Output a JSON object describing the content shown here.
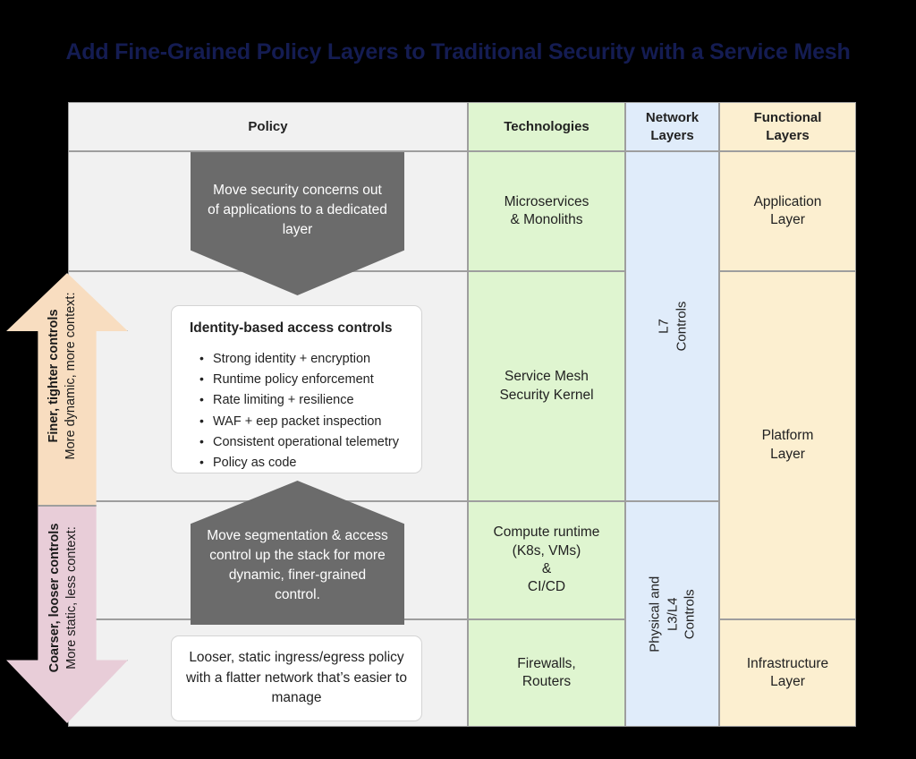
{
  "title": "Add Fine-Grained Policy Layers to Traditional Security with a Service Mesh",
  "colors": {
    "title": "#141c52",
    "policy_column": "#f1f1f1",
    "technologies_column": "#dff5d0",
    "network_layers_column": "#e0ecfa",
    "functional_layers_column": "#fcefd0",
    "callout_gray": "#6b6b6b",
    "arrow_up": "#f8ddc0",
    "arrow_down": "#e8cdd8",
    "card_white": "#ffffff",
    "border": "#9e9e9e"
  },
  "table": {
    "headers": [
      {
        "label": "Policy"
      },
      {
        "label": "Technologies"
      },
      {
        "label": "Network\nLayers"
      },
      {
        "label": "Functional\nLayers"
      }
    ],
    "technologies": [
      {
        "label": "Microservices\n& Monoliths"
      },
      {
        "label": "Service Mesh\nSecurity Kernel"
      },
      {
        "label": "Compute runtime\n(K8s, VMs)\n&\nCI/CD"
      },
      {
        "label": "Firewalls,\nRouters"
      }
    ],
    "network_layers": [
      {
        "label": "L7\nControls"
      },
      {
        "label": "Physical and L3/L4\nControls"
      }
    ],
    "functional_layers": [
      {
        "label": "Application\nLayer"
      },
      {
        "label": "Platform\nLayer"
      },
      {
        "label": "Infrastructure\nLayer"
      }
    ]
  },
  "policy": {
    "callout_top": "Move security concerns out of applications to a dedicated layer",
    "callout_bottom": "Move segmentation & access control up the stack for more dynamic, finer-grained control.",
    "identity_card": {
      "heading": "Identity-based access controls",
      "bullets": [
        "Strong identity + encryption",
        "Runtime policy enforcement",
        "Rate limiting + resilience",
        "WAF + eep packet inspection",
        "Consistent operational telemetry",
        "Policy as code"
      ]
    },
    "looser_card": "Looser, static ingress/egress policy with a flatter network that’s easier to manage"
  },
  "side_arrows": {
    "up": {
      "line1": "More dynamic, more context:",
      "line2": "Finer, tighter controls"
    },
    "down": {
      "line1": "More static, less context:",
      "line2": "Coarser, looser controls"
    }
  }
}
